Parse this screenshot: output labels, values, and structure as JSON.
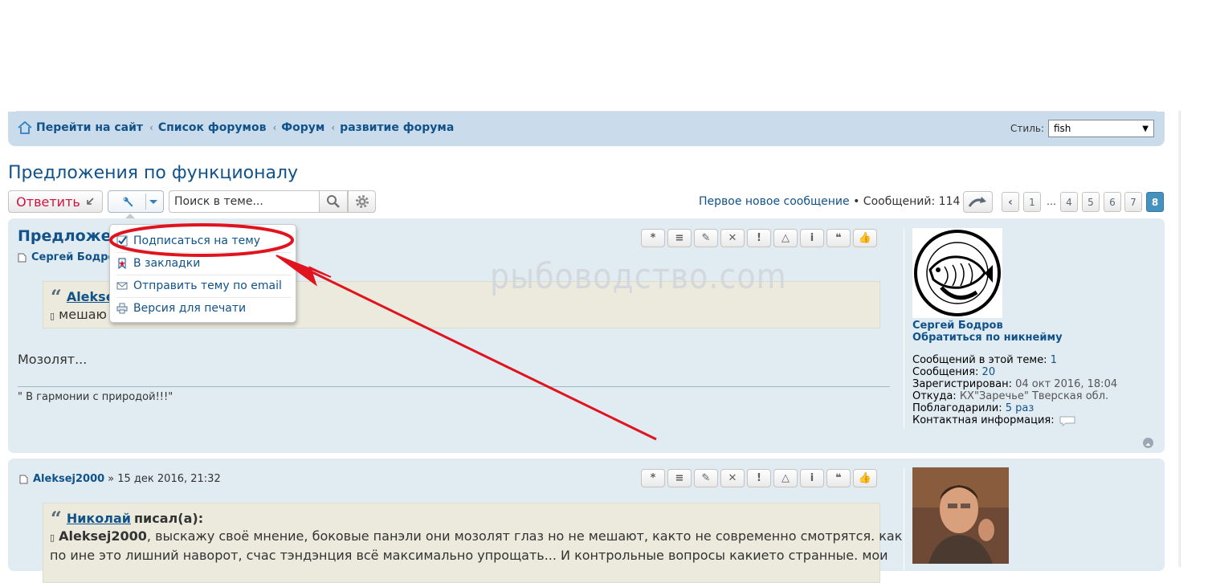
{
  "navbar": {
    "crumbs": [
      "Перейти на сайт",
      "Список форумов",
      "Форум",
      "развитие форума"
    ],
    "style_label": "Стиль:",
    "style_value": "fish"
  },
  "topic": {
    "title": "Предложения по функционалу"
  },
  "actions": {
    "reply_label": "Ответить",
    "search_placeholder": "Поиск в теме...",
    "first_unread": "Первое новое сообщение",
    "posts_count_text": " • Сообщений: 114",
    "pages": [
      "1",
      "4",
      "5",
      "6",
      "7",
      "8"
    ],
    "ellipsis": "…",
    "current_page": "8"
  },
  "dropdown": {
    "items": [
      "Подписаться на тему",
      "В закладки",
      "Отправить тему по email",
      "Версия для печати"
    ]
  },
  "post_buttons": [
    "*",
    "≡",
    "✎",
    "✕",
    "!",
    "△",
    "i",
    "❝",
    "👍"
  ],
  "watermark": "рыбоводство.com",
  "posts": [
    {
      "title": "Предложения по функционалу",
      "title_visible": "Предложен",
      "author_visible": "Сергей Бодров",
      "quote_author": "Aleksej2000",
      "quote_author_visible": "Alekse",
      "quote_text_visible": "мешаю",
      "text": "Мозолят...",
      "signature": "\" В гармонии с природой!!!\"",
      "profile": {
        "name": "Сергей Бодров",
        "pm": "Обратиться по никнейму",
        "stats": [
          {
            "label": "Сообщений в этой теме:",
            "value": "1"
          },
          {
            "label": "Сообщения:",
            "value": "20"
          },
          {
            "label": "Зарегистрирован:",
            "value": "04 окт 2016, 18:04"
          },
          {
            "label": "Откуда:",
            "value": "КХ\"Заречье\" Тверская обл."
          },
          {
            "label": "Поблагодарили:",
            "value": "5 раз"
          },
          {
            "label": "Контактная информация:",
            "value": ""
          }
        ]
      }
    },
    {
      "author": "Aleksej2000",
      "date": "» 15 дек 2016, 21:32",
      "quote_author": "Николай",
      "quote_wrote": "писал(а):",
      "quote_name": "Aleksej2000",
      "quote_line1": ", выскажу своё мнение, боковые панэли они мозолят глаз но не мешают, както не современно смотрятся. как",
      "quote_line2": "по ине это лишний наворот, счас тэндэнция всё максимально упрощать... И контрольные вопросы какието странные. мои"
    }
  ],
  "colors": {
    "link": "#105289",
    "navbar_bg": "#cadceb",
    "post_bg": "#e1ebf2",
    "quote_bg": "#ebeadd",
    "reply_red": "#d31141",
    "active_page": "#4692bf",
    "annotation_red": "#e0141e"
  }
}
